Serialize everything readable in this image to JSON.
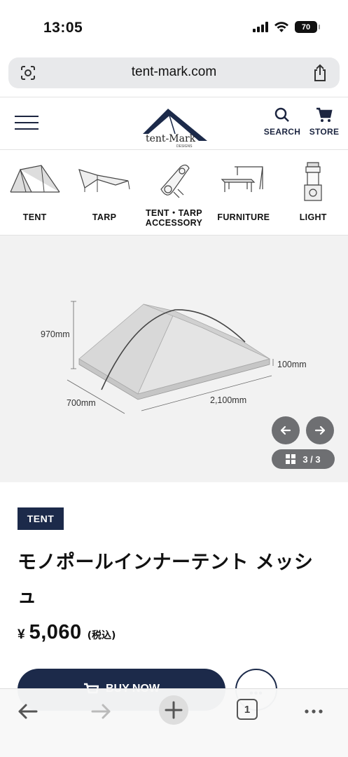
{
  "status_bar": {
    "time": "13:05",
    "battery": "70"
  },
  "browser": {
    "url": "tent-mark.com",
    "tab_count": "1"
  },
  "header": {
    "logo_text": "tent-Mark",
    "logo_sub": "DESIGNS",
    "search_label": "SEARCH",
    "store_label": "STORE"
  },
  "categories": [
    {
      "label": "TENT",
      "icon": "tent-icon"
    },
    {
      "label": "TARP",
      "icon": "tarp-icon"
    },
    {
      "label_line1": "TENT・TARP",
      "label_line2": "ACCESSORY",
      "icon": "accessory-icon"
    },
    {
      "label": "FURNITURE",
      "icon": "furniture-icon"
    },
    {
      "label": "LIGHT",
      "icon": "light-icon"
    }
  ],
  "gallery": {
    "dimensions": {
      "height": "970mm",
      "width": "700mm",
      "length": "2,100mm",
      "floor": "100mm"
    },
    "counter": "3 / 3"
  },
  "product": {
    "tag": "TENT",
    "title": "モノポールインナーテント メッシュ",
    "price_symbol": "¥",
    "price": "5,060",
    "tax_note": "(税込)",
    "buy_label": "BUY NOW"
  },
  "colors": {
    "navy": "#1c2a4a",
    "gallery_bg": "#f2f2f2"
  }
}
